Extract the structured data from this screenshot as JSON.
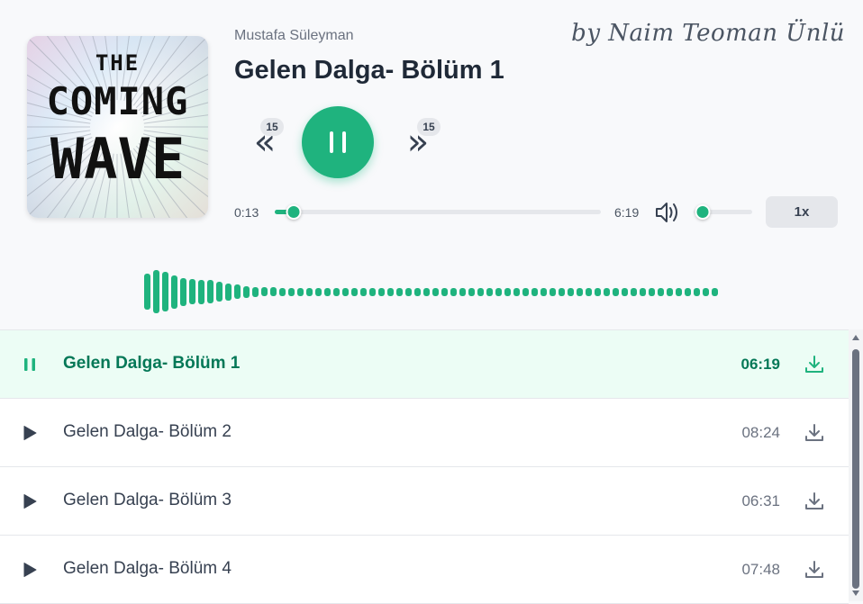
{
  "player": {
    "author": "Mustafa Süleyman",
    "title": "Gelen Dalga- Bölüm 1",
    "signature": "by Naim Teoman Ünlü",
    "cover": {
      "line1": "THE",
      "line2": "COMING",
      "line3": "WAVE",
      "icon": "book-cover-image"
    },
    "skip_back": {
      "label": "15",
      "icon": "rewind-15-icon"
    },
    "skip_forward": {
      "label": "15",
      "icon": "forward-15-icon"
    },
    "play_state": "playing",
    "current_time": "0:13",
    "duration": "6:19",
    "progress_fraction": 0.034,
    "volume_fraction": 0.15,
    "speed": "1x",
    "accent_color": "#1fb37e"
  },
  "waveform": {
    "levels": [
      0.72,
      0.86,
      0.78,
      0.66,
      0.56,
      0.5,
      0.48,
      0.46,
      0.4,
      0.34,
      0.28,
      0.24,
      0.2,
      0.18,
      0.17,
      0.16,
      0.16,
      0.16,
      0.16,
      0.16,
      0.16,
      0.16,
      0.16,
      0.16,
      0.16,
      0.16,
      0.16,
      0.16,
      0.16,
      0.16,
      0.16,
      0.16,
      0.16,
      0.16,
      0.16,
      0.16,
      0.16,
      0.16,
      0.16,
      0.16,
      0.16,
      0.16,
      0.16,
      0.16,
      0.16,
      0.16,
      0.16,
      0.16,
      0.16,
      0.16,
      0.16,
      0.16,
      0.16,
      0.16,
      0.16,
      0.16,
      0.16,
      0.16,
      0.16,
      0.16,
      0.16,
      0.16,
      0.16,
      0.16
    ]
  },
  "playlist": [
    {
      "name": "Gelen Dalga- Bölüm 1",
      "duration": "06:19",
      "active": true,
      "state_icon": "pause-icon"
    },
    {
      "name": "Gelen Dalga- Bölüm 2",
      "duration": "08:24",
      "active": false,
      "state_icon": "play-icon"
    },
    {
      "name": "Gelen Dalga- Bölüm 3",
      "duration": "06:31",
      "active": false,
      "state_icon": "play-icon"
    },
    {
      "name": "Gelen Dalga- Bölüm 4",
      "duration": "07:48",
      "active": false,
      "state_icon": "play-icon"
    }
  ]
}
